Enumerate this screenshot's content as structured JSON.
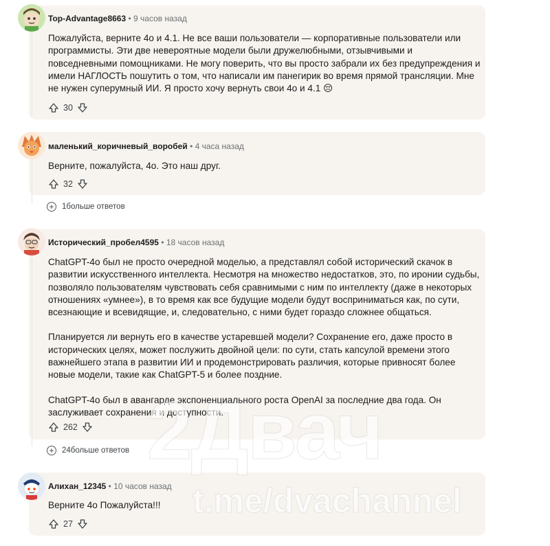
{
  "comments": [
    {
      "username": "Top-Advantage8663",
      "dot": "•",
      "time": "9 часов назад",
      "paragraphs": [
        "Пожалуйста, верните 4о и 4.1. Не все ваши пользователи — корпоративные пользователи или программисты. Эти две невероятные модели были дружелюбными, отзывчивыми и повседневными помощниками. Не могу поверить, что вы просто забрали их без предупреждения и имели НАГЛОСТЬ пошутить о том, что написали им панегирик во время прямой трансляции. Мне не нужен суперумный ИИ. Я просто хочу вернуть свои 4о и 4.1 😔"
      ],
      "votes": "30"
    },
    {
      "username": "маленький_коричневый_воробей",
      "dot": "•",
      "time": "4 часа назад",
      "paragraphs": [
        "Верните, пожалуйста, 4о. Это наш друг."
      ],
      "votes": "32",
      "more_replies": "1больше ответов"
    },
    {
      "username": "Исторический_пробел4595",
      "dot": "•",
      "time": "18 часов назад",
      "paragraphs": [
        "ChatGPT-4o был не просто очередной моделью, а представлял собой исторический скачок в развитии искусственного интеллекта. Несмотря на множество недостатков, это, по иронии судьбы, позволяло пользователям чувствовать себя сравнимыми с ним по интеллекту (даже в некоторых отношениях «умнее»), в то время как все будущие модели будут восприниматься как, по сути, всезнающие и всевидящие, и, следовательно, с ними будет гораздо сложнее общаться.",
        "Планируется ли вернуть его в качестве устаревшей модели? Сохранение его, даже просто в исторических целях, может послужить двойной цели: по сути, стать капсулой времени этого важнейшего этапа в развитии ИИ и продемонстрировать различия, которые привносят более новые модели, такие как ChatGPT-5 и более поздние.",
        "ChatGPT-4o был в авангарде экспоненциального роста OpenAI за последние два года. Он заслуживает сохранения и доступности."
      ],
      "votes": "262",
      "more_replies": "24больше ответов"
    },
    {
      "username": "Алихан_12345",
      "dot": "•",
      "time": "10 часов назад",
      "paragraphs": [
        "Верните 4о Пожалуйста!!!"
      ],
      "votes": "27"
    }
  ],
  "watermark": {
    "logo": "2Двач",
    "handle": "t.me/dvachannel"
  },
  "colors": {
    "card_bg": "#f7f4ef",
    "text": "#1c1c1c",
    "muted": "#6b6f73"
  }
}
